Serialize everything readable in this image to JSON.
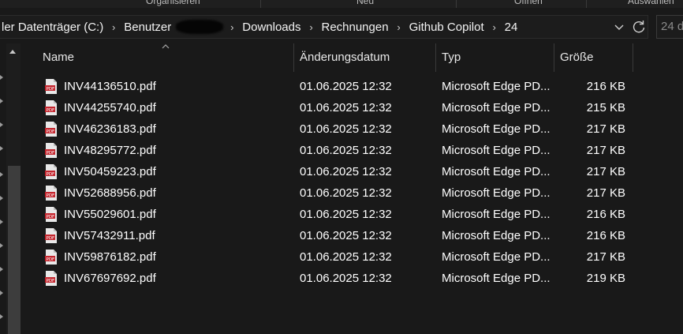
{
  "ribbon": {
    "groups": [
      "Organisieren",
      "Neu",
      "Öffnen",
      "Auswählen"
    ]
  },
  "address": {
    "crumbs": [
      "ler Datenträger (C:)",
      "Benutzer",
      "Downloads",
      "Rechnungen",
      "Github Copilot",
      "24"
    ],
    "search_placeholder": "24 d"
  },
  "columns": {
    "name": "Name",
    "date": "Änderungsdatum",
    "type": "Typ",
    "size": "Größe"
  },
  "files": [
    {
      "name": "INV44136510.pdf",
      "date": "01.06.2025 12:32",
      "type": "Microsoft Edge PD...",
      "size": "216 KB"
    },
    {
      "name": "INV44255740.pdf",
      "date": "01.06.2025 12:32",
      "type": "Microsoft Edge PD...",
      "size": "215 KB"
    },
    {
      "name": "INV46236183.pdf",
      "date": "01.06.2025 12:32",
      "type": "Microsoft Edge PD...",
      "size": "217 KB"
    },
    {
      "name": "INV48295772.pdf",
      "date": "01.06.2025 12:32",
      "type": "Microsoft Edge PD...",
      "size": "217 KB"
    },
    {
      "name": "INV50459223.pdf",
      "date": "01.06.2025 12:32",
      "type": "Microsoft Edge PD...",
      "size": "217 KB"
    },
    {
      "name": "INV52688956.pdf",
      "date": "01.06.2025 12:32",
      "type": "Microsoft Edge PD...",
      "size": "217 KB"
    },
    {
      "name": "INV55029601.pdf",
      "date": "01.06.2025 12:32",
      "type": "Microsoft Edge PD...",
      "size": "216 KB"
    },
    {
      "name": "INV57432911.pdf",
      "date": "01.06.2025 12:32",
      "type": "Microsoft Edge PD...",
      "size": "216 KB"
    },
    {
      "name": "INV59876182.pdf",
      "date": "01.06.2025 12:32",
      "type": "Microsoft Edge PD...",
      "size": "217 KB"
    },
    {
      "name": "INV67697692.pdf",
      "date": "01.06.2025 12:32",
      "type": "Microsoft Edge PD...",
      "size": "219 KB"
    }
  ],
  "icons": {
    "file": "pdf-file-icon",
    "refresh": "refresh-icon",
    "dropdown": "chevron-down-icon",
    "breadcrumb_separator": "chevron-right-icon"
  },
  "colors": {
    "background": "#191919",
    "pdf_red": "#c4262e"
  }
}
